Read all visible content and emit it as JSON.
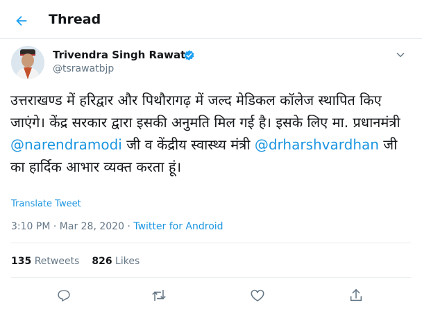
{
  "header": {
    "title": "Thread"
  },
  "tweet": {
    "author": {
      "name": "Trivendra Singh Rawat",
      "handle": "@tsrawatbjp",
      "verified": true
    },
    "text_parts": {
      "p1": "उत्तराखण्ड में हरिद्वार और पिथौरागढ़ में जल्द मेडिकल कॉलेज स्थापित किए जाएंगे। केंद्र सरकार द्वारा इसकी अनुमति मिल गई है। इसके लिए मा. प्रधानमंत्री ",
      "m1": "@narendramodi",
      "p2": " जी व केंद्रीय स्वास्थ्य मंत्री ",
      "m2": "@drharshvardhan",
      "p3": " जी का हार्दिक आभार व्यक्त करता हूं।"
    },
    "translate_label": "Translate Tweet",
    "time": "3:10 PM",
    "dot1": " · ",
    "date": "Mar 28, 2020",
    "dot2": " · ",
    "source": "Twitter for Android",
    "retweets_count": "135",
    "retweets_label": "Retweets",
    "likes_count": "826",
    "likes_label": "Likes"
  },
  "icons": {
    "back": "arrow-left-icon",
    "verified": "verified-badge-icon",
    "caret": "chevron-down-icon",
    "reply": "reply-icon",
    "retweet": "retweet-icon",
    "like": "heart-icon",
    "share": "share-icon"
  },
  "colors": {
    "accent": "#1da1f2",
    "link": "#1b95e0",
    "text": "#14171a",
    "muted": "#657786",
    "divider": "#e6ecf0"
  }
}
